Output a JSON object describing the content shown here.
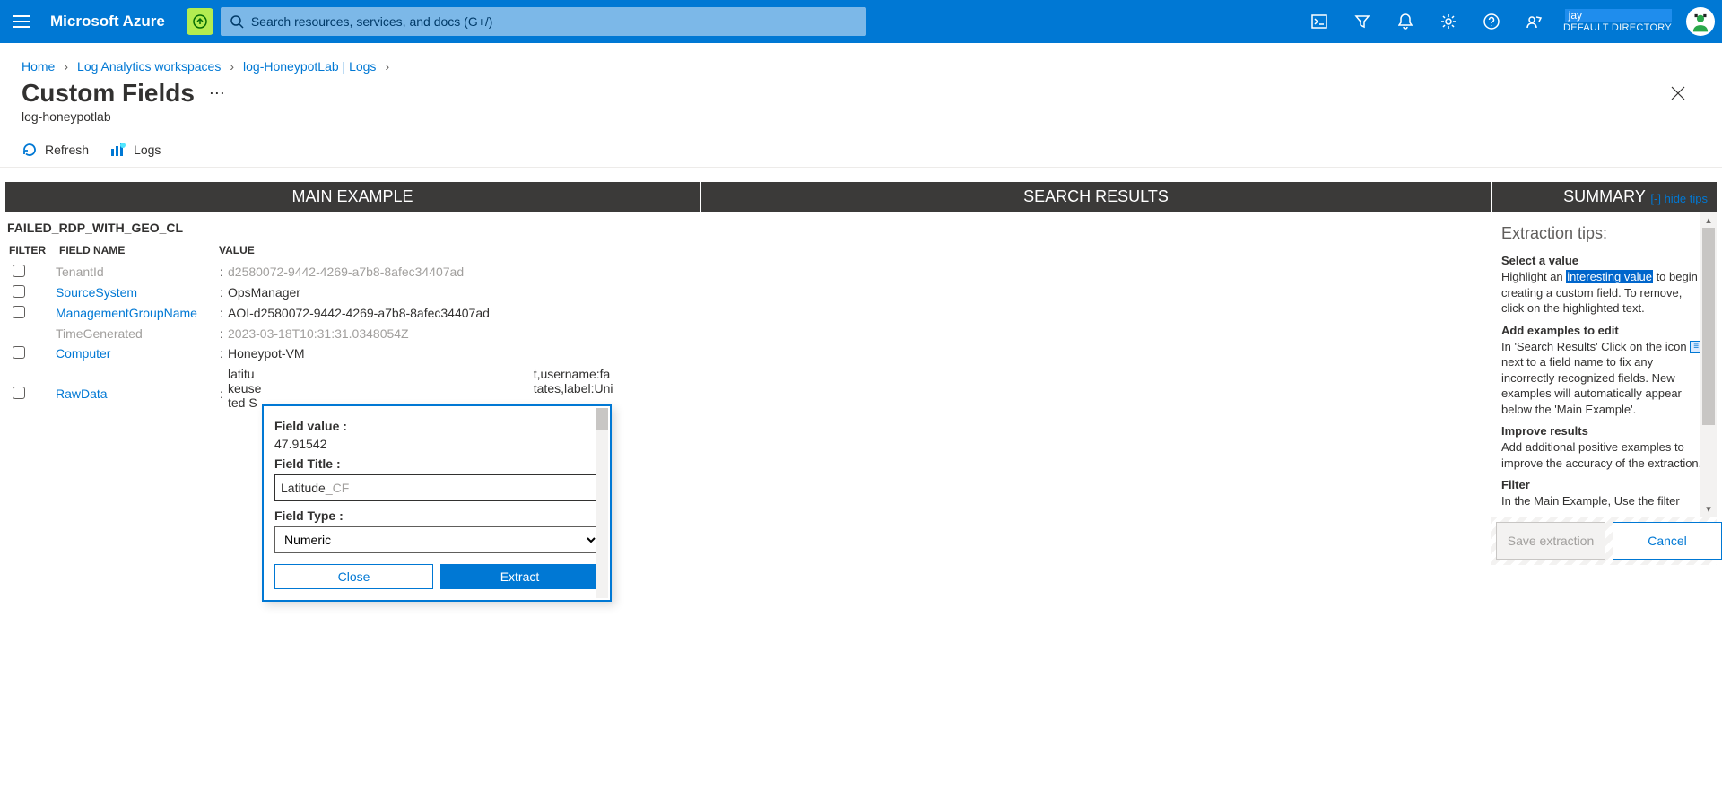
{
  "header": {
    "brand": "Microsoft Azure",
    "search_placeholder": "Search resources, services, and docs (G+/)",
    "account_name": "jay",
    "account_dir": "DEFAULT DIRECTORY"
  },
  "breadcrumb": {
    "items": [
      "Home",
      "Log Analytics workspaces",
      "log-HoneypotLab | Logs"
    ]
  },
  "page": {
    "title": "Custom Fields",
    "subtitle": "log-honeypotlab"
  },
  "toolbar": {
    "refresh": "Refresh",
    "logs": "Logs"
  },
  "columns": {
    "main": "MAIN EXAMPLE",
    "search_results": "SEARCH RESULTS",
    "summary": "SUMMARY"
  },
  "hide_tips": "[-] hide tips",
  "table": {
    "name": "FAILED_RDP_WITH_GEO_CL",
    "hdr_filter": "FILTER",
    "hdr_field": "FIELD NAME",
    "hdr_value": "VALUE",
    "rows": [
      {
        "field": "TenantId",
        "value": "d2580072-9442-4269-a7b8-8afec34407ad",
        "muted": true,
        "checkbox": true
      },
      {
        "field": "SourceSystem",
        "value": "OpsManager",
        "muted": false,
        "checkbox": true
      },
      {
        "field": "ManagementGroupName",
        "value": "AOI-d2580072-9442-4269-a7b8-8afec34407ad",
        "muted": false,
        "checkbox": true
      },
      {
        "field": "TimeGenerated",
        "value": "2023-03-18T10:31:31.0348054Z",
        "muted": true,
        "checkbox": false
      },
      {
        "field": "Computer",
        "value": "Honeypot-VM",
        "muted": false,
        "checkbox": true
      },
      {
        "field": "RawData",
        "value": "latitu                                                                                t,username:fa\nkeuse                                                                              tates,label:Uni\nted S",
        "muted": false,
        "checkbox": true
      }
    ]
  },
  "popup": {
    "fv_label": "Field value :",
    "fv_value": "47.91542",
    "ft_label": "Field Title :",
    "ft_value": "Latitude",
    "ft_suffix": "_CF",
    "ftype_label": "Field Type :",
    "ftype_value": "Numeric",
    "close": "Close",
    "extract": "Extract"
  },
  "summary": {
    "heading": "Extraction tips:",
    "tips": [
      {
        "title": "Select a value",
        "body_pre": "Highlight an ",
        "body_hl": "interesting value",
        "body_post": " to begin creating a custom field. To remove, click on the highlighted text."
      },
      {
        "title": "Add examples to edit",
        "body_pre": "In 'Search Results' Click on the icon ",
        "body_post": " next to a field name to fix any incorrectly recognized fields. New examples will automatically appear below the 'Main Example'."
      },
      {
        "title": "Improve results",
        "body": "Add additional positive examples to improve the accuracy of the extraction."
      },
      {
        "title": "Filter",
        "body": "In the Main Example, Use the filter"
      }
    ],
    "save": "Save extraction",
    "cancel": "Cancel"
  }
}
